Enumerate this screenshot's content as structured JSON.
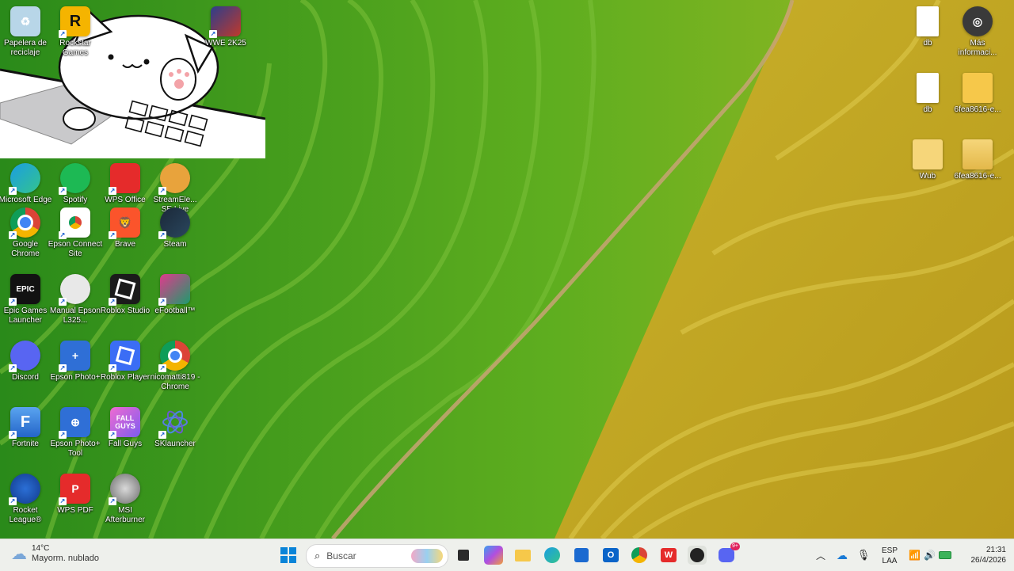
{
  "desktop_icons": {
    "recycle_bin": "Papelera de reciclaje",
    "rockstar": "Rockstar Games",
    "wwe": "WWE 2K25",
    "edge": "Microsoft Edge",
    "spotify": "Spotify",
    "wps_office": "WPS Office",
    "streamelements": "StreamEle... SE.Live",
    "chrome": "Google Chrome",
    "epson_connect": "Epson Connect Site",
    "brave": "Brave",
    "steam": "Steam",
    "epic": "Epic Games Launcher",
    "manual_epson": "Manual Epson L325...",
    "roblox_studio": "Roblox Studio",
    "efootball": "eFootball™",
    "discord": "Discord",
    "epson_photo": "Epson Photo+",
    "roblox_player": "Roblox Player",
    "nicomatti": "nicomatti819 - Chrome",
    "fortnite": "Fortnite",
    "epson_photo_tool": "Epson Photo+ Tool",
    "fall_guys": "Fall Guys",
    "sklauncher": "SKlauncher",
    "rocket_league": "Rocket League®",
    "wps_pdf": "WPS PDF",
    "msi_afterburner": "MSI Afterburner",
    "db1": "db",
    "mas_info": "Más informaci...",
    "db2": "db",
    "folder_6fea": "6fea8616-e...",
    "wub": "Wub",
    "zip_6fea": "6fea8616-e..."
  },
  "icon_glyphs": {
    "rockstar": "R",
    "epic": "EPIC",
    "fortnite": "F",
    "fall_guys": "FALL GUYS"
  },
  "taskbar": {
    "weather_temp": "14°C",
    "weather_condition": "Mayorm. nublado",
    "search_placeholder": "Buscar",
    "language_top": "ESP",
    "language_bottom": "LAA",
    "time": "21:31",
    "date": "26/4/2026",
    "discord_badge": "9+"
  },
  "colors": {
    "taskbar_bg": "#eef0ec",
    "accent_blue": "#0067c0"
  }
}
